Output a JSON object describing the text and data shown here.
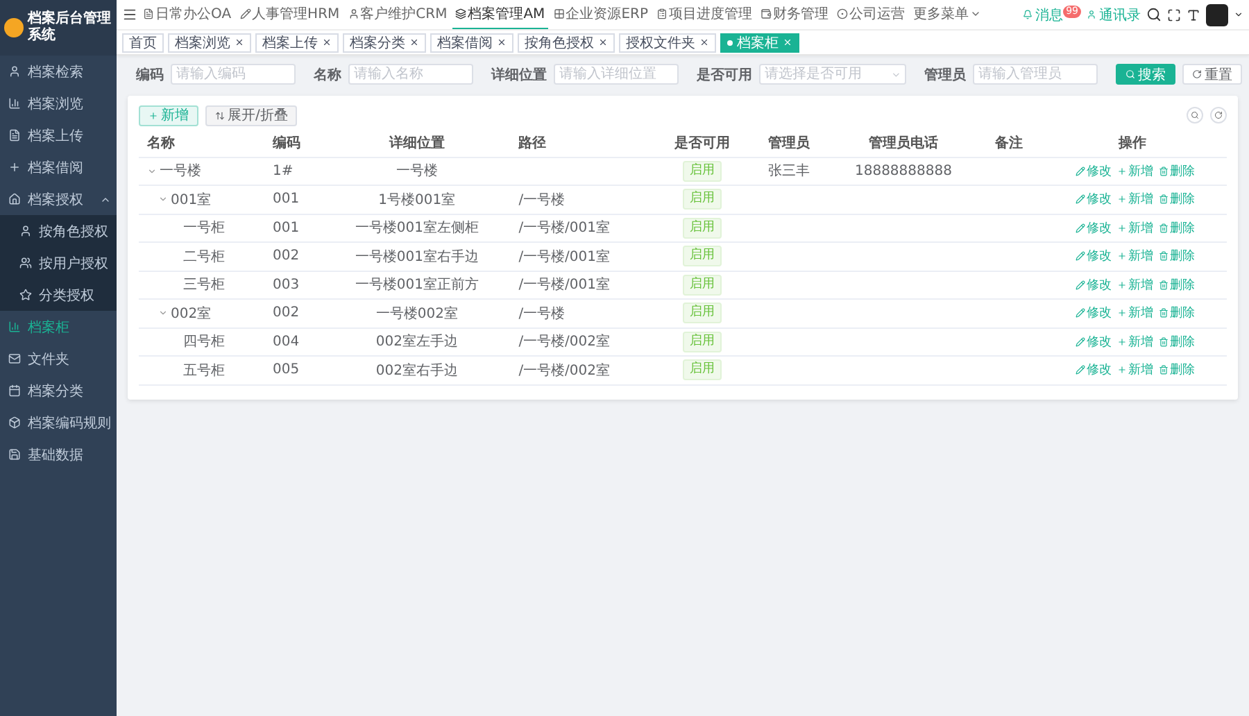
{
  "app": {
    "title": "档案后台管理系统"
  },
  "sidebar": {
    "items": [
      {
        "label": "档案检索",
        "selected": false
      },
      {
        "label": "档案浏览",
        "selected": false
      },
      {
        "label": "档案上传",
        "selected": false
      },
      {
        "label": "档案借阅",
        "selected": false
      },
      {
        "label": "档案授权",
        "selected": false,
        "expanded": true,
        "children": [
          {
            "label": "按角色授权",
            "selected": false
          },
          {
            "label": "按用户授权",
            "selected": false
          },
          {
            "label": "分类授权",
            "selected": false
          }
        ]
      },
      {
        "label": "档案柜",
        "selected": true
      },
      {
        "label": "文件夹",
        "selected": false
      },
      {
        "label": "档案分类",
        "selected": false
      },
      {
        "label": "档案编码规则",
        "selected": false
      },
      {
        "label": "基础数据",
        "selected": false
      }
    ]
  },
  "top_nav": {
    "items": [
      {
        "label": "日常办公OA",
        "selected": false
      },
      {
        "label": "人事管理HRM",
        "selected": false
      },
      {
        "label": "客户维护CRM",
        "selected": false
      },
      {
        "label": "档案管理AM",
        "selected": true
      },
      {
        "label": "企业资源ERP",
        "selected": false
      },
      {
        "label": "项目进度管理",
        "selected": false
      },
      {
        "label": "财务管理",
        "selected": false
      },
      {
        "label": "公司运营",
        "selected": false
      }
    ],
    "more": "更多菜单",
    "message": {
      "label": "消息",
      "badge": "99"
    },
    "contacts": "通讯录"
  },
  "tags": [
    {
      "label": "首页",
      "selected": false,
      "closable": false
    },
    {
      "label": "档案浏览",
      "selected": false,
      "closable": true
    },
    {
      "label": "档案上传",
      "selected": false,
      "closable": true
    },
    {
      "label": "档案分类",
      "selected": false,
      "closable": true
    },
    {
      "label": "档案借阅",
      "selected": false,
      "closable": true
    },
    {
      "label": "按角色授权",
      "selected": false,
      "closable": true
    },
    {
      "label": "授权文件夹",
      "selected": false,
      "closable": true
    },
    {
      "label": "档案柜",
      "selected": true,
      "closable": true
    }
  ],
  "search": {
    "fields": [
      {
        "label": "编码",
        "placeholder": "请输入编码",
        "kind": "input"
      },
      {
        "label": "名称",
        "placeholder": "请输入名称",
        "kind": "input"
      },
      {
        "label": "详细位置",
        "placeholder": "请输入详细位置",
        "kind": "input"
      },
      {
        "label": "是否可用",
        "placeholder": "请选择是否可用",
        "kind": "select"
      },
      {
        "label": "管理员",
        "placeholder": "请输入管理员",
        "kind": "input"
      }
    ],
    "search_button": "搜索",
    "reset_button": "重置"
  },
  "toolbar": {
    "add": "新增",
    "toggle": "展开/折叠"
  },
  "table": {
    "columns": [
      "名称",
      "编码",
      "详细位置",
      "路径",
      "是否可用",
      "管理员",
      "管理员电话",
      "备注",
      "操作"
    ],
    "rows": [
      {
        "name": "一号楼",
        "code": "1#",
        "location": "一号楼",
        "status": "启用",
        "manager": "张三丰",
        "phone": "18888888888",
        "actions": [
          "修改",
          "新增",
          "删除"
        ],
        "expanded": true,
        "children": [
          {
            "name": "001室",
            "code": "001",
            "location": "1号楼001室",
            "path": "/一号楼",
            "status": "启用",
            "actions": [
              "修改",
              "新增",
              "删除"
            ],
            "expanded": true,
            "children": [
              {
                "name": "一号柜",
                "code": "001",
                "location": "一号楼001室左侧柜",
                "path": "/一号楼/001室",
                "status": "启用",
                "actions": [
                  "修改",
                  "新增",
                  "删除"
                ]
              },
              {
                "name": "二号柜",
                "code": "002",
                "location": "一号楼001室右手边",
                "path": "/一号楼/001室",
                "status": "启用",
                "actions": [
                  "修改",
                  "新增",
                  "删除"
                ]
              },
              {
                "name": "三号柜",
                "code": "003",
                "location": "一号楼001室正前方",
                "path": "/一号楼/001室",
                "status": "启用",
                "actions": [
                  "修改",
                  "新增",
                  "删除"
                ]
              }
            ]
          },
          {
            "name": "002室",
            "code": "002",
            "location": "一号楼002室",
            "path": "/一号楼",
            "status": "启用",
            "actions": [
              "修改",
              "新增",
              "删除"
            ],
            "expanded": true,
            "children": [
              {
                "name": "四号柜",
                "code": "004",
                "location": "002室左手边",
                "path": "/一号楼/002室",
                "status": "启用",
                "actions": [
                  "修改",
                  "新增",
                  "删除"
                ]
              },
              {
                "name": "五号柜",
                "code": "005",
                "location": "002室右手边",
                "path": "/一号楼/002室",
                "status": "启用",
                "actions": [
                  "修改",
                  "新增",
                  "删除"
                ]
              }
            ]
          }
        ]
      }
    ]
  }
}
